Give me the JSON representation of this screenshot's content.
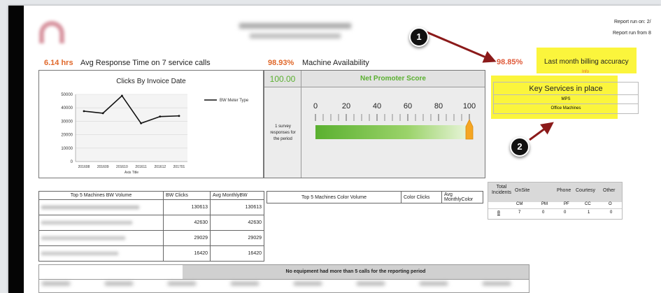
{
  "header": {
    "report_run_on": "Report run on: 2/",
    "report_run_from": "Report run from 8"
  },
  "kpis": {
    "response_value": "6.14 hrs",
    "response_label": "Avg Response Time on 7 service calls",
    "availability_value": "98.93%",
    "availability_label": "Machine Availability",
    "billing_value": "98.85%",
    "billing_label": "Last month billing accuracy",
    "info_label": "Info"
  },
  "callouts": {
    "one": "1",
    "two": "2"
  },
  "colors": {
    "accent_orange": "#e0682a",
    "highlight": "#fbf53c",
    "arrow": "#8b1a1a",
    "nps_green": "#5ab030"
  },
  "clicks_chart": {
    "title": "Clicks By Invoice Date",
    "x_axis_title": "Axis Title",
    "chart_data": {
      "type": "line",
      "title": "Clicks By Invoice Date",
      "xlabel": "Axis Title",
      "ylabel": "",
      "categories": [
        "201608",
        "201609",
        "201610",
        "201611",
        "201612",
        "201701"
      ],
      "series": [
        {
          "name": "BW Meter Type",
          "values": [
            37500,
            36000,
            49000,
            28500,
            33500,
            34000
          ]
        }
      ],
      "ylim": [
        0,
        50000
      ],
      "yticks": [
        "50000",
        "40000",
        "30000",
        "20000",
        "10000",
        "0"
      ],
      "ytick_values": [
        50000,
        40000,
        30000,
        20000,
        10000,
        0
      ],
      "legend": "top-right",
      "grid": true
    }
  },
  "nps": {
    "score": "100.00",
    "title": "Net Promoter Score",
    "survey_text": "1 survey responses for the period",
    "gauge_value": 100,
    "gauge_ticks": [
      "0",
      "20",
      "40",
      "60",
      "80",
      "100"
    ]
  },
  "key_services": {
    "title": "Key Services in place",
    "items": [
      "MPS",
      "Office Machines"
    ]
  },
  "top5_bw": {
    "headers": [
      "Top 5 Machines BW Volume",
      "BW Clicks",
      "Avg MonthlyBW"
    ],
    "rows": [
      {
        "clicks": "130613",
        "avg": "130613"
      },
      {
        "clicks": "42630",
        "avg": "42630"
      },
      {
        "clicks": "29029",
        "avg": "29029"
      },
      {
        "clicks": "16420",
        "avg": "16420"
      }
    ]
  },
  "top5_color": {
    "headers": [
      "Top 5 Machines Color Volume",
      "Color Clicks",
      "Avg MonthlyColor"
    ]
  },
  "incidents": {
    "total_label": "Total Incidents",
    "headers": [
      "OnSite",
      "Phone",
      "Courtesy",
      "Other"
    ],
    "sub_headers": [
      "CM",
      "PM",
      "PF",
      "CC",
      "O"
    ],
    "total_value": "8",
    "values": [
      "7",
      "0",
      "0",
      "1",
      "0"
    ]
  },
  "equipment": {
    "message": "No equipment had more than 5 calls for the reporting period"
  }
}
